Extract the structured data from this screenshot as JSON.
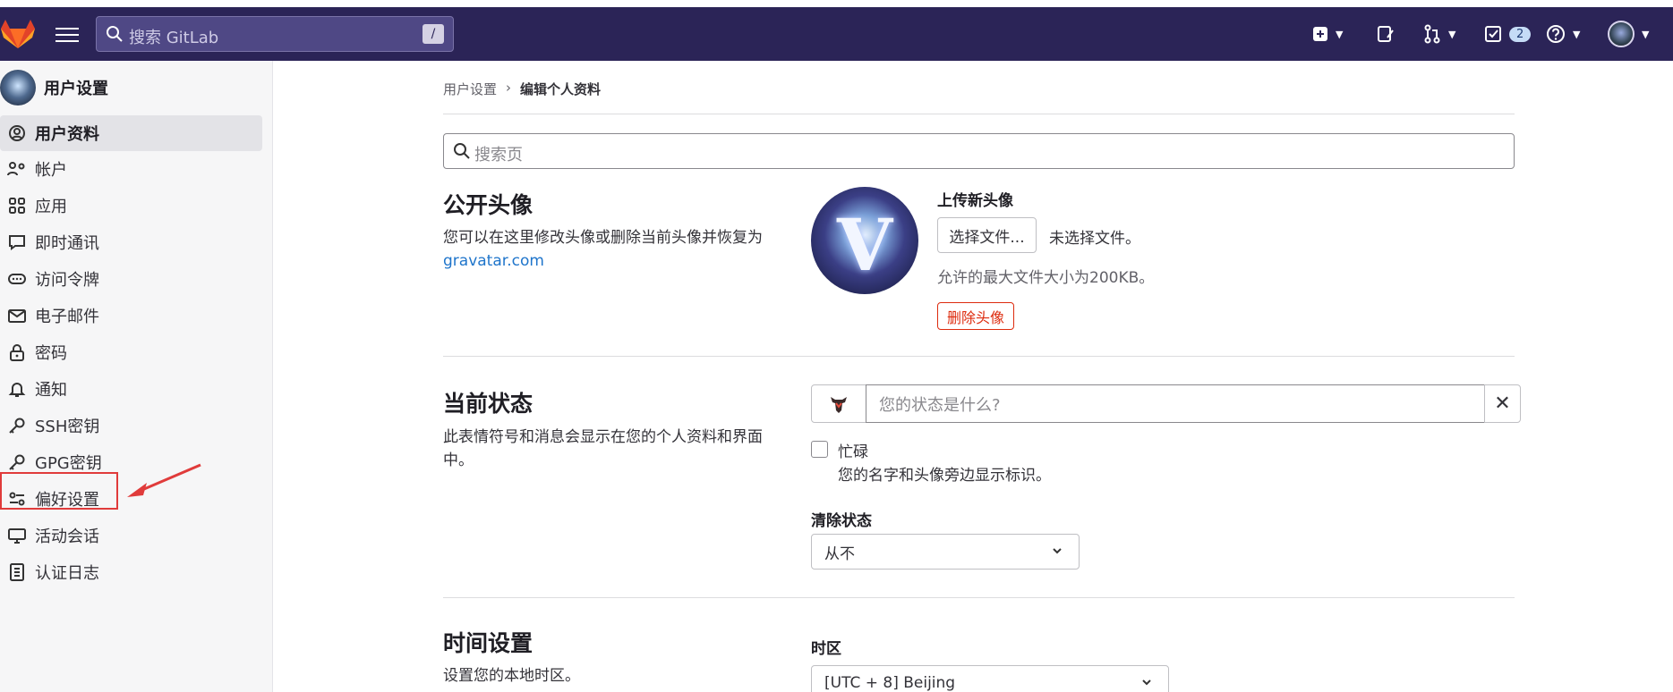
{
  "topbar": {
    "search_placeholder": "搜索 GitLab",
    "search_shortcut": "/",
    "todo_count": "2"
  },
  "sidebar": {
    "title": "用户设置",
    "items": [
      {
        "label": "用户资料",
        "icon": "user-icon",
        "active": true
      },
      {
        "label": "帐户",
        "icon": "account-icon"
      },
      {
        "label": "应用",
        "icon": "applications-icon"
      },
      {
        "label": "即时通讯",
        "icon": "comment-icon"
      },
      {
        "label": "访问令牌",
        "icon": "token-icon"
      },
      {
        "label": "电子邮件",
        "icon": "mail-icon"
      },
      {
        "label": "密码",
        "icon": "lock-icon"
      },
      {
        "label": "通知",
        "icon": "bell-icon"
      },
      {
        "label": "SSH密钥",
        "icon": "key-icon"
      },
      {
        "label": "GPG密钥",
        "icon": "key-icon"
      },
      {
        "label": "偏好设置",
        "icon": "preferences-icon"
      },
      {
        "label": "活动会话",
        "icon": "monitor-icon"
      },
      {
        "label": "认证日志",
        "icon": "log-icon"
      }
    ]
  },
  "breadcrumb": {
    "parent": "用户设置",
    "separator": "›",
    "current": "编辑个人资料"
  },
  "page_search": {
    "placeholder": "搜索页"
  },
  "avatar_section": {
    "title": "公开头像",
    "desc": "您可以在这里修改头像或删除当前头像并恢复为",
    "link": "gravatar.com",
    "upload_title": "上传新头像",
    "choose_file": "选择文件...",
    "no_file": "未选择文件。",
    "max_size": "允许的最大文件大小为200KB。",
    "remove": "删除头像"
  },
  "status_section": {
    "title": "当前状态",
    "desc": "此表情符号和消息会显示在您的个人资料和界面中。",
    "placeholder": "您的状态是什么?",
    "busy_label": "忙碌",
    "busy_help": "您的名字和头像旁边显示标识。",
    "clear_label": "清除状态",
    "clear_value": "从不"
  },
  "time_section": {
    "title": "时间设置",
    "desc": "设置您的本地时区。",
    "tz_label": "时区",
    "tz_value": "[UTC + 8] Beijing"
  },
  "colors": {
    "topbar": "#2b2457",
    "link": "#1f75cb",
    "danger": "#dd2b0e",
    "annotation": "#e03b3b"
  }
}
